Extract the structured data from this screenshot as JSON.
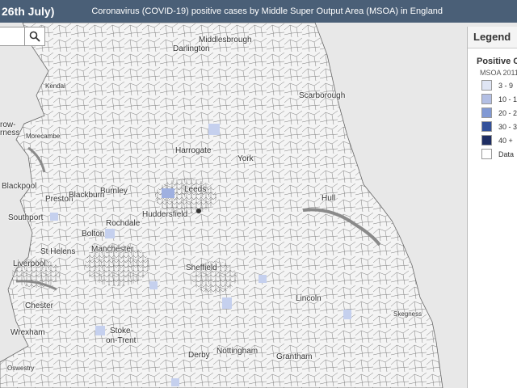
{
  "header": {
    "date": "26th July)",
    "title": "Coronavirus (COVID-19) positive cases by Middle Super Output Area (MSOA) in England"
  },
  "search": {
    "value": "",
    "clear_glyph": "✕"
  },
  "legend": {
    "title": "Legend",
    "layer_title": "Positive C",
    "subtitle": "MSOA 2011",
    "classes": [
      {
        "label": "3 - 9",
        "color": "#dfe5f4"
      },
      {
        "label": "10 - 1",
        "color": "#b3bfe4"
      },
      {
        "label": "20 - 2",
        "color": "#8199d4"
      },
      {
        "label": "30 - 3",
        "color": "#33519b"
      },
      {
        "label": "40 +",
        "color": "#1e2d62"
      },
      {
        "label": "Data",
        "color": "#ffffff"
      }
    ]
  },
  "places": [
    {
      "name": "Middlesbrough",
      "size": "md"
    },
    {
      "name": "Darlington",
      "size": "md"
    },
    {
      "name": "Kendal",
      "size": "sm"
    },
    {
      "name": "Scarborough",
      "size": "md"
    },
    {
      "name": "row-",
      "size": "md"
    },
    {
      "name": "rness",
      "size": "md"
    },
    {
      "name": "Morecambe",
      "size": "sm"
    },
    {
      "name": "Harrogate",
      "size": "md"
    },
    {
      "name": "York",
      "size": "md"
    },
    {
      "name": "Blackpool",
      "size": "md"
    },
    {
      "name": "Leeds",
      "size": "md"
    },
    {
      "name": "Burnley",
      "size": "md"
    },
    {
      "name": "Preston",
      "size": "md"
    },
    {
      "name": "Blackburn",
      "size": "md"
    },
    {
      "name": "Hull",
      "size": "md"
    },
    {
      "name": "Huddersfield",
      "size": "md"
    },
    {
      "name": "Southport",
      "size": "md"
    },
    {
      "name": "Rochdale",
      "size": "md"
    },
    {
      "name": "Bolton",
      "size": "md"
    },
    {
      "name": "St Helens",
      "size": "md"
    },
    {
      "name": "Manchester",
      "size": "md"
    },
    {
      "name": "Liverpool",
      "size": "md"
    },
    {
      "name": "Sheffield",
      "size": "md"
    },
    {
      "name": "Lincoln",
      "size": "md"
    },
    {
      "name": "Chester",
      "size": "md"
    },
    {
      "name": "Skegness",
      "size": "sm"
    },
    {
      "name": "Wrexham",
      "size": "md"
    },
    {
      "name": "Stoke-",
      "size": "md"
    },
    {
      "name": "on-Trent",
      "size": "md"
    },
    {
      "name": "Derby",
      "size": "md"
    },
    {
      "name": "Nottingham",
      "size": "md"
    },
    {
      "name": "Grantham",
      "size": "md"
    },
    {
      "name": "Oswestry",
      "size": "sm"
    }
  ]
}
